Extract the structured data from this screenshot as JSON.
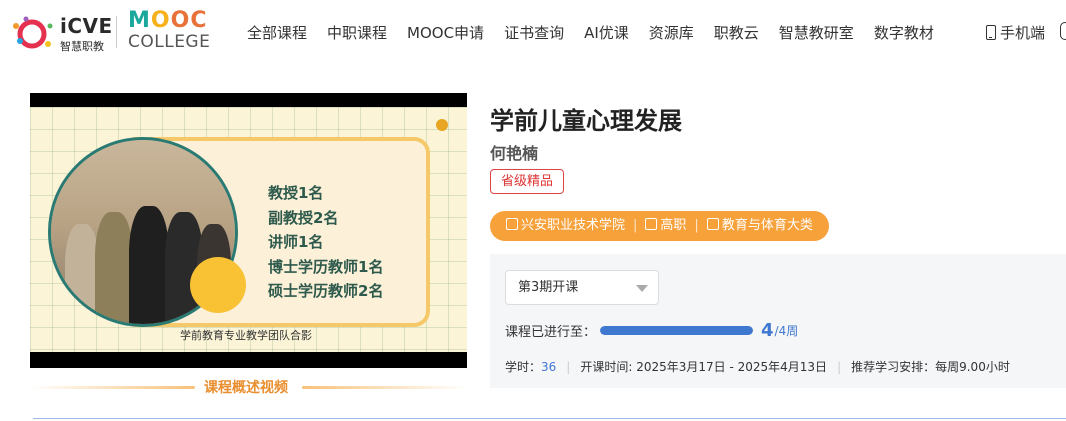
{
  "brand": {
    "icve_text": "iCVE",
    "icve_sub": "智慧职教",
    "mooc_letters": [
      "M",
      "O",
      "O",
      "C"
    ],
    "college_text": "COLLEGE"
  },
  "nav": {
    "items": [
      "全部课程",
      "中职课程",
      "MOOC申请",
      "证书查询",
      "AI优课",
      "资源库",
      "职教云",
      "智慧教研室",
      "数字教材"
    ],
    "mobile_label": "手机端"
  },
  "video": {
    "lines": [
      "教授1名",
      "副教授2名",
      "讲师1名",
      "博士学历教师1名",
      "硕士学历教师2名"
    ],
    "caption": "学前教育专业教学团队合影",
    "label": "课程概述视频"
  },
  "course": {
    "title": "学前儿童心理发展",
    "teacher": "何艳楠",
    "badge": "省级精品",
    "school": "兴安职业技术学院",
    "level": "高职",
    "category": "教育与体育大类",
    "meta_sep": "|"
  },
  "session": {
    "term": "第3期开课",
    "progress_label": "课程已进行至：",
    "progress_current": "4",
    "progress_total": "/4周",
    "progress_fraction": 1.0,
    "hours_label": "学时：",
    "hours_value": "36",
    "schedule": "开课时间: 2025年3月17日 - 2025年4月13日",
    "recommend": "推荐学习安排：每周9.00小时",
    "sep": "|"
  },
  "colors": {
    "accent_blue": "#3f78d1",
    "meta_orange": "#f7a13b",
    "badge_red": "#d33"
  }
}
